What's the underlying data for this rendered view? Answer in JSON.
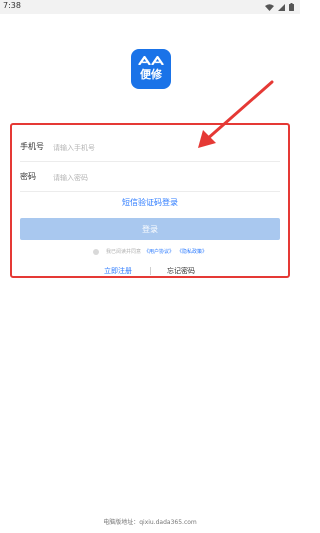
{
  "status_bar": {
    "time": "7:38",
    "icons": [
      "wifi-icon",
      "signal-icon",
      "battery-icon"
    ]
  },
  "logo": {
    "text": "便修",
    "background": "#1a73e8"
  },
  "form": {
    "phone": {
      "label": "手机号",
      "placeholder": "请输入手机号",
      "value": ""
    },
    "password": {
      "label": "密码",
      "placeholder": "请输入密码",
      "value": ""
    }
  },
  "sms_login_label": "短信验证码登录",
  "login_button_label": "登录",
  "agreement": {
    "prefix": "我已阅读并同意",
    "user_agreement": "《用户协议》",
    "privacy_policy": "《隐私政策》"
  },
  "links": {
    "register": "立即注册",
    "forgot_password": "忘记密码"
  },
  "footer": "电脑版地址：qixiu.dada365.com",
  "colors": {
    "accent": "#2979ff",
    "login_button": "#a9c8ef",
    "annotation": "#e53935"
  }
}
